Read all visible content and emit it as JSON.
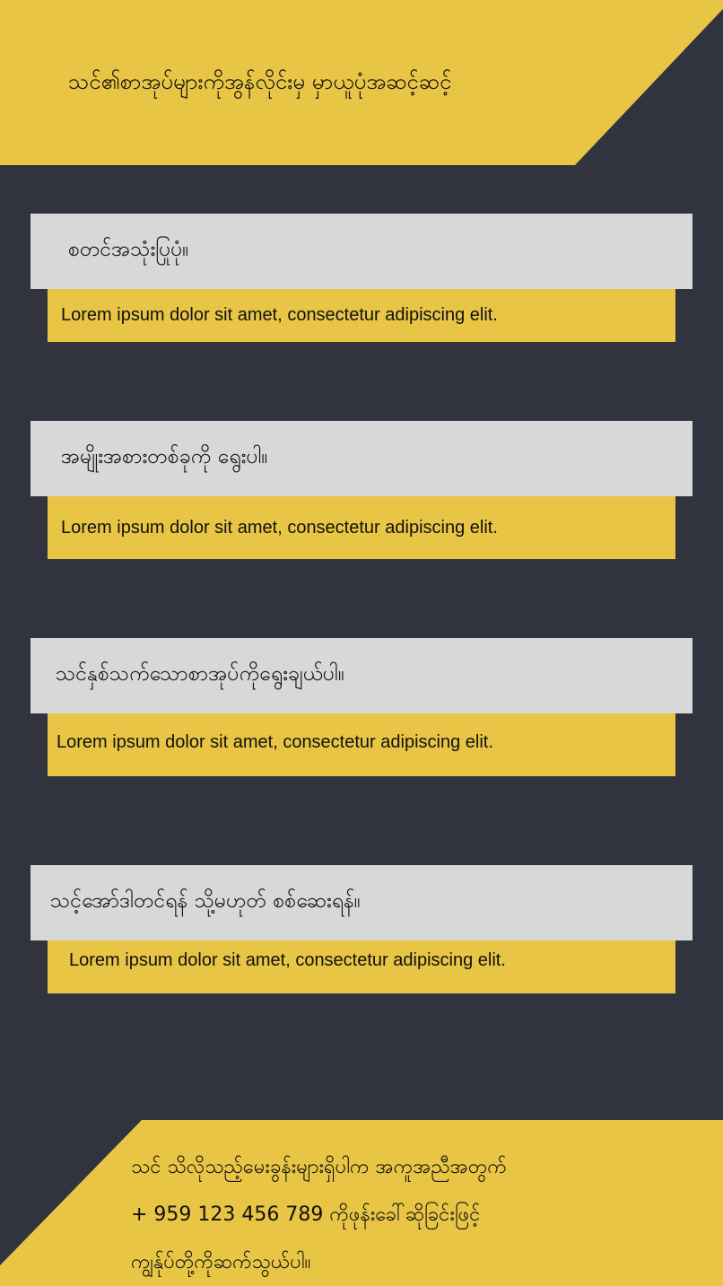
{
  "header": {
    "title": "သင်၏စာအုပ်များကိုအွန်လိုင်းမှ မှာယူပုံအဆင့်ဆင့်"
  },
  "steps": [
    {
      "title": "စတင်အသုံးပြုပုံ။",
      "description": "Lorem ipsum dolor sit amet, consectetur adipiscing elit."
    },
    {
      "title": "အမျိုးအစားတစ်ခုကို ရွေးပါ။",
      "description": "Lorem ipsum dolor sit amet, consectetur adipiscing elit."
    },
    {
      "title": "သင်နှစ်သက်သောစာအုပ်ကိုရွေးချယ်ပါ။",
      "description": "Lorem ipsum dolor sit amet, consectetur adipiscing elit."
    },
    {
      "title": "သင့်အော်ဒါတင်ရန် သို့မဟုတ် စစ်ဆေးရန်။",
      "description": "Lorem ipsum dolor sit amet, consectetur adipiscing elit."
    }
  ],
  "footer": {
    "line1": "သင် သိလိုသည့်မေးခွန်းများရှိပါက အကူအညီအတွက်",
    "line2": "+ 959 123 456 789 ကိုဖုန်းခေါ်ဆိုခြင်းဖြင့်",
    "line3": "ကျွန်ုပ်တို့ကိုဆက်သွယ်ပါ။"
  },
  "colors": {
    "background": "#31333f",
    "accent_yellow": "#e8c545",
    "card_gray": "#d8d8d8",
    "text": "#111111"
  }
}
